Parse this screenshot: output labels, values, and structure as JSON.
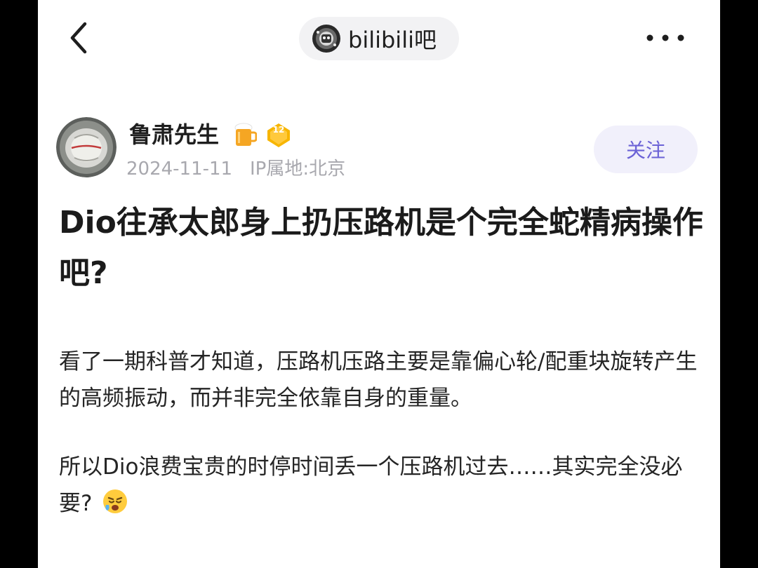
{
  "nav": {
    "back_icon": "chevron-left-icon",
    "forum_name": "bilibili吧",
    "more_icon": "more-horizontal-icon"
  },
  "author": {
    "name": "鲁肃先生",
    "badge_icon": "beer-mug-icon",
    "level": "12",
    "level_color": "#f7b500",
    "date": "2024-11-11",
    "ip_location": "IP属地:北京",
    "follow_label": "关注"
  },
  "post": {
    "title": "Dio往承太郎身上扔压路机是个完全蛇精病操作吧?",
    "paragraphs": [
      "看了一期科普才知道，压路机压路主要是靠偏心轮/配重块旋转产生的高频振动，而并非完全依靠自身的重量。",
      "所以Dio浪费宝贵的时停时间丢一个压路机过去……其实完全没必要?"
    ],
    "emoji_icon": "crying-face-emoji-icon"
  },
  "colors": {
    "accent": "#6b62d6",
    "follow_bg": "#f1f0fb",
    "meta_text": "#a8a8ae"
  }
}
